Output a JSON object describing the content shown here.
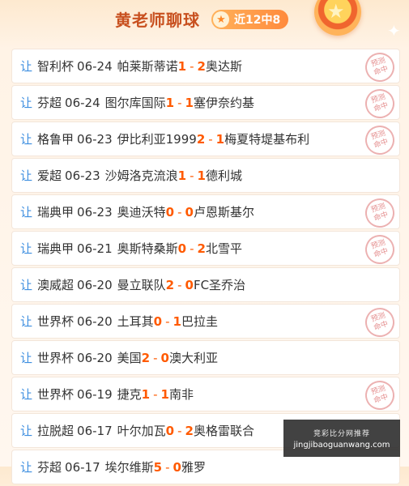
{
  "header": {
    "title": "黄老师聊球",
    "badge": "近12中8"
  },
  "rang_label": "让",
  "stamp_label": [
    "预测",
    "命中"
  ],
  "matches": [
    {
      "league": "智利杯",
      "date": "06-24",
      "home": "帕莱斯蒂诺",
      "home_score": "1",
      "sep": "-",
      "away_score": "2",
      "away": "奥达斯",
      "hit": true
    },
    {
      "league": "芬超",
      "date": "06-24",
      "home": "图尔库国际",
      "home_score": "1",
      "sep": "-",
      "away_score": "1",
      "away": "塞伊奈约基",
      "hit": true
    },
    {
      "league": "格鲁甲",
      "date": "06-23",
      "home": "伊比利亚1999",
      "home_score": "2",
      "sep": "-",
      "away_score": "1",
      "away": "梅夏特堤基布利",
      "hit": true
    },
    {
      "league": "爱超",
      "date": "06-23",
      "home": "沙姆洛克流浪",
      "home_score": "1",
      "sep": "-",
      "away_score": "1",
      "away": "德利城",
      "hit": false
    },
    {
      "league": "瑞典甲",
      "date": "06-23",
      "home": "奥迪沃特",
      "home_score": "0",
      "sep": "-",
      "away_score": "0",
      "away": "卢恩斯基尔",
      "hit": true
    },
    {
      "league": "瑞典甲",
      "date": "06-21",
      "home": "奥斯特桑斯",
      "home_score": "0",
      "sep": "-",
      "away_score": "2",
      "away": "北雪平",
      "hit": true
    },
    {
      "league": "澳威超",
      "date": "06-20",
      "home": "曼立联队",
      "home_score": "2",
      "sep": "-",
      "away_score": "0",
      "away": "FC圣乔治",
      "hit": false
    },
    {
      "league": "世界杯",
      "date": "06-20",
      "home": "土耳其",
      "home_score": "0",
      "sep": "-",
      "away_score": "1",
      "away": "巴拉圭",
      "hit": true
    },
    {
      "league": "世界杯",
      "date": "06-20",
      "home": "美国",
      "home_score": "2",
      "sep": "-",
      "away_score": "0",
      "away": "澳大利亚",
      "hit": false
    },
    {
      "league": "世界杯",
      "date": "06-19",
      "home": "捷克",
      "home_score": "1",
      "sep": "-",
      "away_score": "1",
      "away": "南非",
      "hit": true
    },
    {
      "league": "拉脱超",
      "date": "06-17",
      "home": "叶尔加瓦",
      "home_score": "0",
      "sep": "-",
      "away_score": "2",
      "away": "奥格雷联合",
      "hit": false
    },
    {
      "league": "芬超",
      "date": "06-17",
      "home": "埃尔维斯",
      "home_score": "5",
      "sep": "-",
      "away_score": "0",
      "away": "雅罗",
      "hit": false
    }
  ],
  "watermark": {
    "line1": "竞彩比分网推荐",
    "line2": "jingjibaoguanwang.com"
  },
  "colors": {
    "accent": "#ff5a00",
    "title": "#c8501f",
    "rang": "#3d8ee0",
    "stamp": "#e07b7b"
  }
}
